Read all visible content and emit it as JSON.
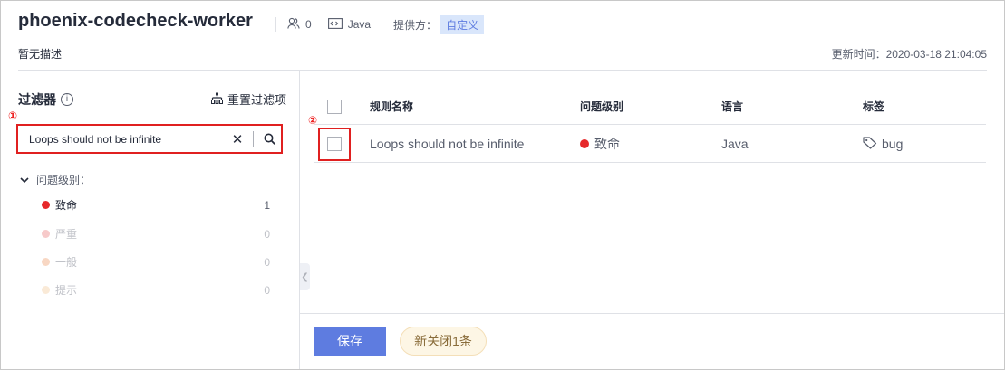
{
  "colors": {
    "fatal": "#e6292b",
    "serious": "#f7caca",
    "general": "#f8d7c3",
    "hint": "#faead7",
    "primary": "#5e7ce0",
    "muted": "#c0c2c8",
    "close_bg": "#fdf6e5",
    "close_text": "#8a6d3b"
  },
  "header": {
    "title": "phoenix-codecheck-worker",
    "member_icon": "users-icon",
    "member_count": "0",
    "language_icon": "code-icon",
    "language": "Java",
    "provider_label": "提供方：",
    "provider_tag": "自定义",
    "description": "暂无描述",
    "updated": "更新时间：2020-03-18 21:04:05"
  },
  "filter": {
    "title": "过滤器",
    "info_icon": "info-icon",
    "reset_icon": "reset-filter-icon",
    "reset_label": "重置过滤项",
    "annotation_1": "①",
    "search_value": "Loops should not be infinite",
    "clear_icon": "close-icon",
    "search_icon": "search-icon",
    "group_label": "问题级别：",
    "severities": [
      {
        "label": "致命",
        "count": "1"
      },
      {
        "label": "严重",
        "count": "0"
      },
      {
        "label": "一般",
        "count": "0"
      },
      {
        "label": "提示",
        "count": "0"
      }
    ]
  },
  "table": {
    "annotation_2": "②",
    "columns": [
      "规则名称",
      "问题级别",
      "语言",
      "标签"
    ],
    "rows": [
      {
        "name": "Loops should not be infinite",
        "level": "致命",
        "language": "Java",
        "tag_icon": "tag-icon",
        "tag": "bug"
      }
    ]
  },
  "footer": {
    "save_label": "保存",
    "close_label": "新关闭1条"
  },
  "collapse_icon": "chevron-left-icon"
}
